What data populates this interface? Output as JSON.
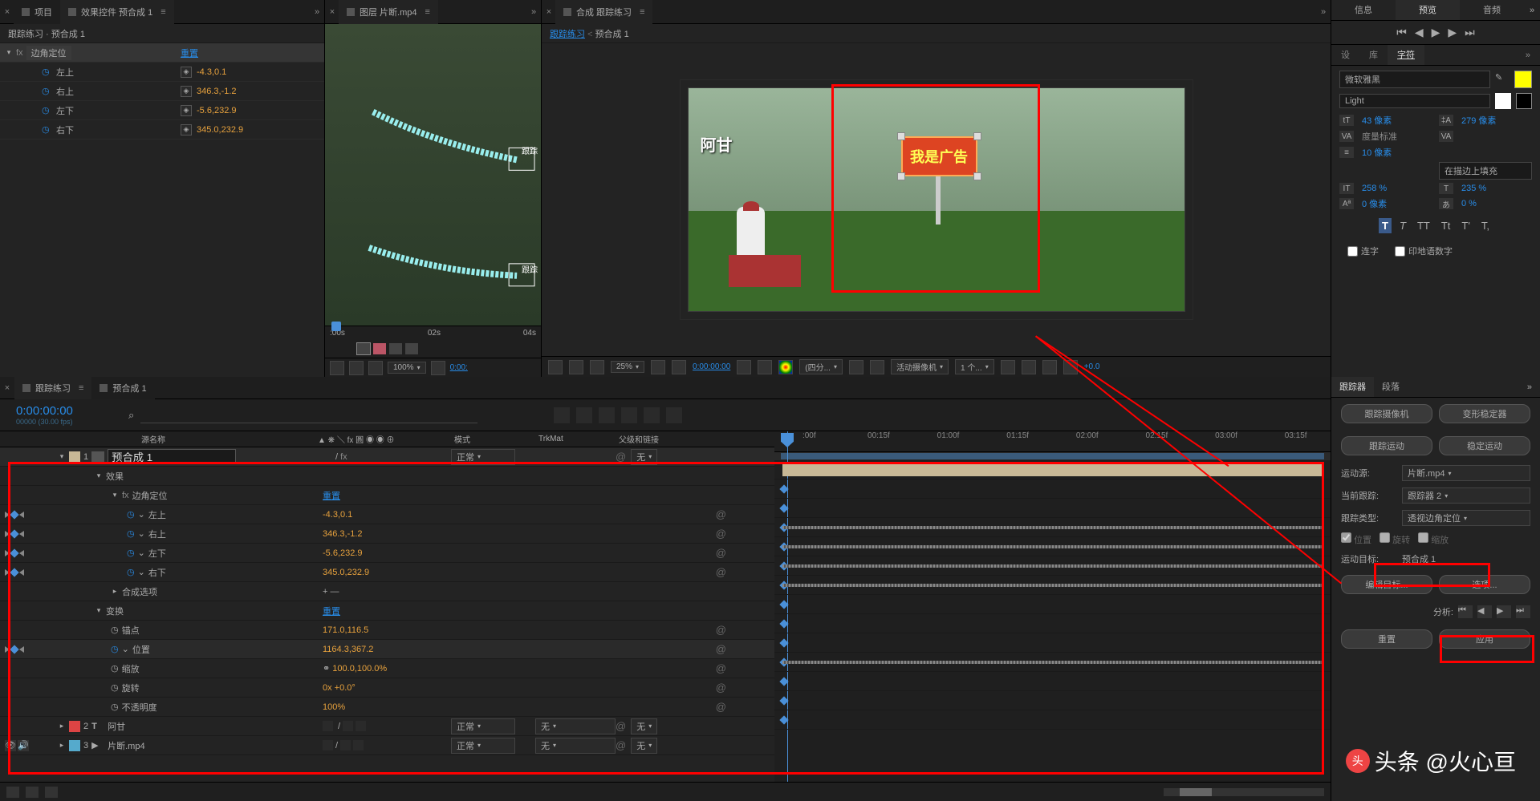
{
  "effects": {
    "tab_project": "项目",
    "tab_title": "效果控件 预合成 1",
    "breadcrumb": "跟踪练习 · 预合成 1",
    "fx_name": "边角定位",
    "reset": "重置",
    "props": [
      {
        "name": "左上",
        "val": "-4.3,0.1"
      },
      {
        "name": "右上",
        "val": "346.3,-1.2"
      },
      {
        "name": "左下",
        "val": "-5.6,232.9"
      },
      {
        "name": "右下",
        "val": "345.0,232.9"
      }
    ]
  },
  "layer": {
    "tab": "图层 片断.mp4",
    "ruler": {
      "t0": ":00s",
      "t1": "02s",
      "t2": "04s"
    },
    "footer": {
      "zoom": "100%",
      "time": "0:00:"
    },
    "labels": {
      "track": "跟踪"
    }
  },
  "comp": {
    "tab": "合成 跟踪练习",
    "bc1": "跟踪练习",
    "bc2": "预合成 1",
    "overlay": "阿甘",
    "sign": "我是广告",
    "footer": {
      "zoom": "25%",
      "time": "0:00:00:00",
      "quality": "(四分...",
      "camera": "活动摄像机",
      "views": "1 个...",
      "exposure": "+0.0"
    }
  },
  "right": {
    "pre_tabs": [
      "信息",
      "预览",
      "音频"
    ],
    "char_tabs": [
      "设",
      "库",
      "字符"
    ],
    "font": "微软雅黑",
    "style": "Light",
    "size": "43 像素",
    "leading": "279 像素",
    "kerning": "度量标准",
    "tracking": "10 像素",
    "fill": "在描边上填充",
    "vscale": "258 %",
    "hscale": "235 %",
    "baseline": "0 像素",
    "tsume": "0 %",
    "faux": [
      "T",
      "T",
      "TT",
      "Tt",
      "T'",
      "T,"
    ],
    "liga": "连字",
    "hindi": "印地语数字"
  },
  "timeline": {
    "tabs": [
      "跟踪练习",
      "预合成 1"
    ],
    "timecode": "0:00:00:00",
    "frames": "00000 (30.00 fps)",
    "search_ph": "",
    "ruler": [
      ":00f",
      "00:15f",
      "01:00f",
      "01:15f",
      "02:00f",
      "02:15f",
      "03:00f",
      "03:15f"
    ],
    "cols": {
      "name": "源名称",
      "mode": "模式",
      "trk": "TrkMat",
      "parent": "父级和链接"
    },
    "layers": [
      {
        "idx": "1",
        "color": "#c8b896",
        "name": "预合成 1",
        "mode": "正常",
        "parent": "无"
      },
      {
        "idx": "2",
        "color": "#d44",
        "name": "阿甘",
        "mode": "正常",
        "trk": "无",
        "parent": "无",
        "icon": "T"
      },
      {
        "idx": "3",
        "color": "#5ac",
        "name": "片断.mp4",
        "mode": "正常",
        "trk": "无",
        "parent": "无",
        "icon": "▶"
      }
    ],
    "effects_label": "效果",
    "corner_pin": "边角定位",
    "reset": "重置",
    "transform": "变换",
    "compose_opts": "合成选项",
    "props": {
      "anchor": {
        "n": "锚点",
        "v": "171.0,116.5"
      },
      "position": {
        "n": "位置",
        "v": "1164.3,367.2"
      },
      "scale": {
        "n": "缩放",
        "v": "100.0,100.0%"
      },
      "rotation": {
        "n": "旋转",
        "v": "0x +0.0°"
      },
      "opacity": {
        "n": "不透明度",
        "v": "100%"
      }
    }
  },
  "tracker": {
    "tabs": [
      "跟踪器",
      "段落"
    ],
    "btns1": [
      "跟踪摄像机",
      "变形稳定器"
    ],
    "btns2": [
      "跟踪运动",
      "稳定运动"
    ],
    "source_label": "运动源:",
    "source": "片断.mp4",
    "current_label": "当前跟踪:",
    "current": "跟踪器 2",
    "type_label": "跟踪类型:",
    "type": "透视边角定位",
    "checks": [
      "位置",
      "旋转",
      "缩放"
    ],
    "target_label": "运动目标:",
    "target": "预合成 1",
    "btns3": [
      "编辑目标...",
      "选项..."
    ],
    "analyze": "分析:",
    "btns4": [
      "重置",
      "应用"
    ]
  },
  "watermark": "头条 @火心亘"
}
